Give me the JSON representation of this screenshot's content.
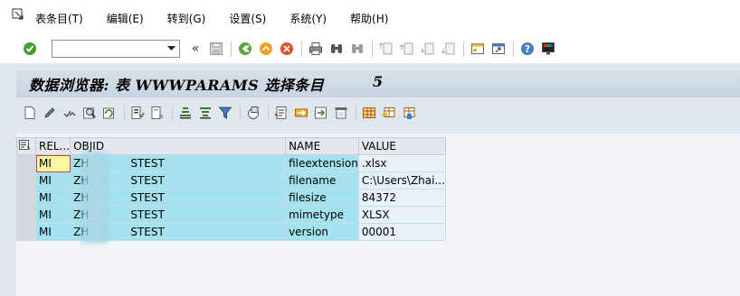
{
  "menu": {
    "items": [
      {
        "label": "表条目(T)"
      },
      {
        "label": "编辑(E)"
      },
      {
        "label": "转到(G)"
      },
      {
        "label": "设置(S)"
      },
      {
        "label": "系统(Y)"
      },
      {
        "label": "帮助(H)"
      }
    ]
  },
  "toolbar": {
    "command_value": "",
    "back_label": "«"
  },
  "title": {
    "text": "数据浏览器: 表 WWWPARAMS 选择条目",
    "count": "5"
  },
  "grid": {
    "columns": [
      "RELID",
      "OBJID",
      "NAME",
      "VALUE"
    ],
    "column_headers": [
      "REL...",
      "OBJID",
      "NAME",
      "VALUE"
    ],
    "rows": [
      {
        "relid": "MI",
        "objid_prefix": "ZH",
        "objid_suffix": "STEST",
        "name": "fileextension",
        "value": ".xlsx"
      },
      {
        "relid": "MI",
        "objid_prefix": "ZH",
        "objid_suffix": "STEST",
        "name": "filename",
        "value": "C:\\Users\\Zhai..."
      },
      {
        "relid": "MI",
        "objid_prefix": "ZH",
        "objid_suffix": "STEST",
        "name": "filesize",
        "value": "84372"
      },
      {
        "relid": "MI",
        "objid_prefix": "ZH",
        "objid_suffix": "STEST",
        "name": "mimetype",
        "value": "XLSX"
      },
      {
        "relid": "MI",
        "objid_prefix": "ZH",
        "objid_suffix": "STEST",
        "name": "version",
        "value": "00001"
      }
    ]
  },
  "colors": {
    "key_cell": "#a3e2ee",
    "value_cell": "#e9f1f8",
    "title_band": "#dfe6ee",
    "current_cell": "#fff5a3"
  },
  "icons": {
    "toolbar": [
      "enter-icon",
      "save-icon",
      "back-icon",
      "exit-icon",
      "cancel-icon",
      "print-icon",
      "find-icon",
      "find-next-icon",
      "first-page-icon",
      "previous-page-icon",
      "next-page-icon",
      "last-page-icon",
      "new-session-icon",
      "shortcut-icon",
      "help-icon",
      "layout-icon"
    ],
    "alv": [
      "details-icon",
      "edit-icon",
      "check-table-icon",
      "search-icon",
      "refresh-icon",
      "select-all-icon",
      "deselect-all-icon",
      "sort-ascending-icon",
      "sort-descending-icon",
      "filter-icon",
      "total-icon",
      "export-icon",
      "print-preview-icon",
      "local-file-icon",
      "mail-icon",
      "layout-grid-icon",
      "change-layout-icon",
      "save-layout-icon"
    ]
  }
}
